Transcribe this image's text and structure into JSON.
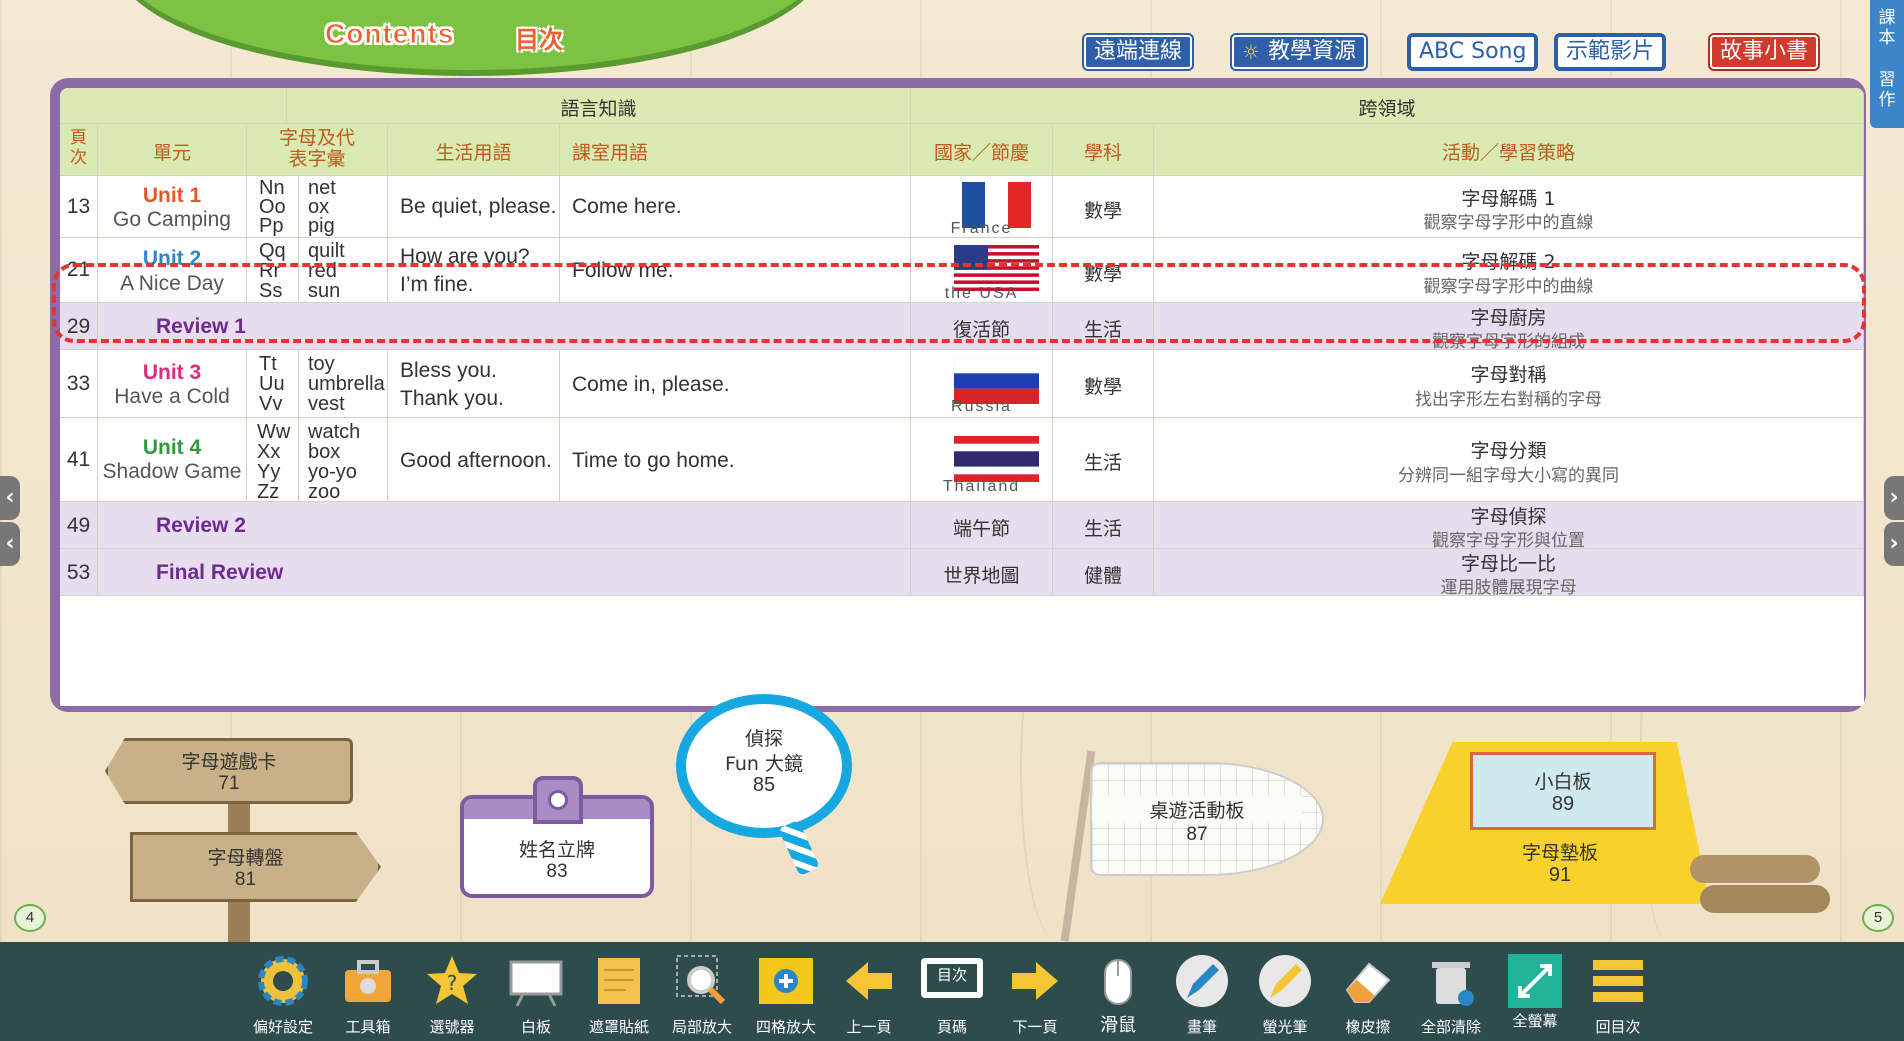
{
  "header": {
    "title": "Contents",
    "title_cn": "目次"
  },
  "top_buttons": [
    "遠端連線",
    "教學資源",
    "ABC Song",
    "示範影片",
    "故事小書"
  ],
  "side_tabs": [
    "課本",
    "習作"
  ],
  "table": {
    "group_headers": {
      "language": "語言知識",
      "cross": "跨領域"
    },
    "columns": [
      "頁次",
      "單元",
      "字母及代表字彙",
      "生活用語",
      "課室用語",
      "國家／節慶",
      "學科",
      "活動／學習策略"
    ],
    "rows": [
      {
        "page": "13",
        "unit": "Unit 1",
        "unit_name": "Go Camping",
        "unit_color": "#e8562a",
        "letters": [
          "Nn",
          "Oo",
          "Pp"
        ],
        "words": [
          "net",
          "ox",
          "pig"
        ],
        "life": [
          "Be quiet, please."
        ],
        "class": "Come here.",
        "country": "France",
        "subject": "數學",
        "activity": "字母解碼 1",
        "strategy": "觀察字母字形中的直線"
      },
      {
        "page": "21",
        "unit": "Unit 2",
        "unit_name": "A Nice Day",
        "unit_color": "#2d86c9",
        "letters": [
          "Qq",
          "Rr",
          "Ss"
        ],
        "words": [
          "quilt",
          "red",
          "sun"
        ],
        "life": [
          "How are you?",
          "I’m fine."
        ],
        "class": "Follow me.",
        "country": "the USA",
        "subject": "數學",
        "activity": "字母解碼 2",
        "strategy": "觀察字母字形中的曲線"
      },
      {
        "page": "29",
        "review": "Review 1",
        "festival": "復活節",
        "subject": "生活",
        "activity": "字母廚房",
        "strategy": "觀察字母字形的組成"
      },
      {
        "page": "33",
        "unit": "Unit 3",
        "unit_name": "Have a Cold",
        "unit_color": "#e0297a",
        "letters": [
          "Tt",
          "Uu",
          "Vv"
        ],
        "words": [
          "toy",
          "umbrella",
          "vest"
        ],
        "life": [
          "Bless you.",
          "Thank you."
        ],
        "class": "Come in, please.",
        "country": "Russia",
        "subject": "數學",
        "activity": "字母對稱",
        "strategy": "找出字形左右對稱的字母"
      },
      {
        "page": "41",
        "unit": "Unit 4",
        "unit_name": "Shadow Game",
        "unit_color": "#2e9a3e",
        "letters": [
          "Ww",
          "Xx",
          "Yy",
          "Zz"
        ],
        "words": [
          "watch",
          "box",
          "yo-yo",
          "zoo"
        ],
        "life": [
          "Good afternoon."
        ],
        "class": "Time to go home.",
        "country": "Thailand",
        "subject": "生活",
        "activity": "字母分類",
        "strategy": "分辨同一組字母大小寫的異同"
      },
      {
        "page": "49",
        "review": "Review 2",
        "festival": "端午節",
        "subject": "生活",
        "activity": "字母偵探",
        "strategy": "觀察字母字形與位置"
      },
      {
        "page": "53",
        "review": "Final Review",
        "festival": "世界地圖",
        "subject": "健體",
        "activity": "字母比一比",
        "strategy": "運用肢體展現字母"
      }
    ]
  },
  "scene": {
    "sign1": {
      "label": "字母遊戲卡",
      "page": "71"
    },
    "sign2": {
      "label": "字母轉盤",
      "page": "81"
    },
    "nametag": {
      "label": "姓名立牌",
      "page": "83"
    },
    "magnifier": {
      "label1": "偵探",
      "label2": "Fun 大鏡",
      "page": "85"
    },
    "flagboard": {
      "label": "桌遊活動板",
      "page": "87"
    },
    "tent1": {
      "label": "小白板",
      "page": "89"
    },
    "tent2": {
      "label": "字母墊板",
      "page": "91"
    },
    "page_left": "4",
    "page_right": "5"
  },
  "toolbar": [
    "偏好設定",
    "工具箱",
    "選號器",
    "白板",
    "遮罩貼紙",
    "局部放大",
    "四格放大",
    "上一頁",
    "頁碼",
    "下一頁",
    "滑鼠",
    "畫筆",
    "螢光筆",
    "橡皮擦",
    "全部清除",
    "全螢幕",
    "回目次"
  ],
  "toolbar_page_icon_text": "目次",
  "colors": {
    "accent_green": "#7cc243",
    "panel_purple": "#8d6aa8",
    "header_row": "#d9eab2",
    "toolbar_bg": "#2f4c4c",
    "highlight_dash": "#e3342f"
  }
}
